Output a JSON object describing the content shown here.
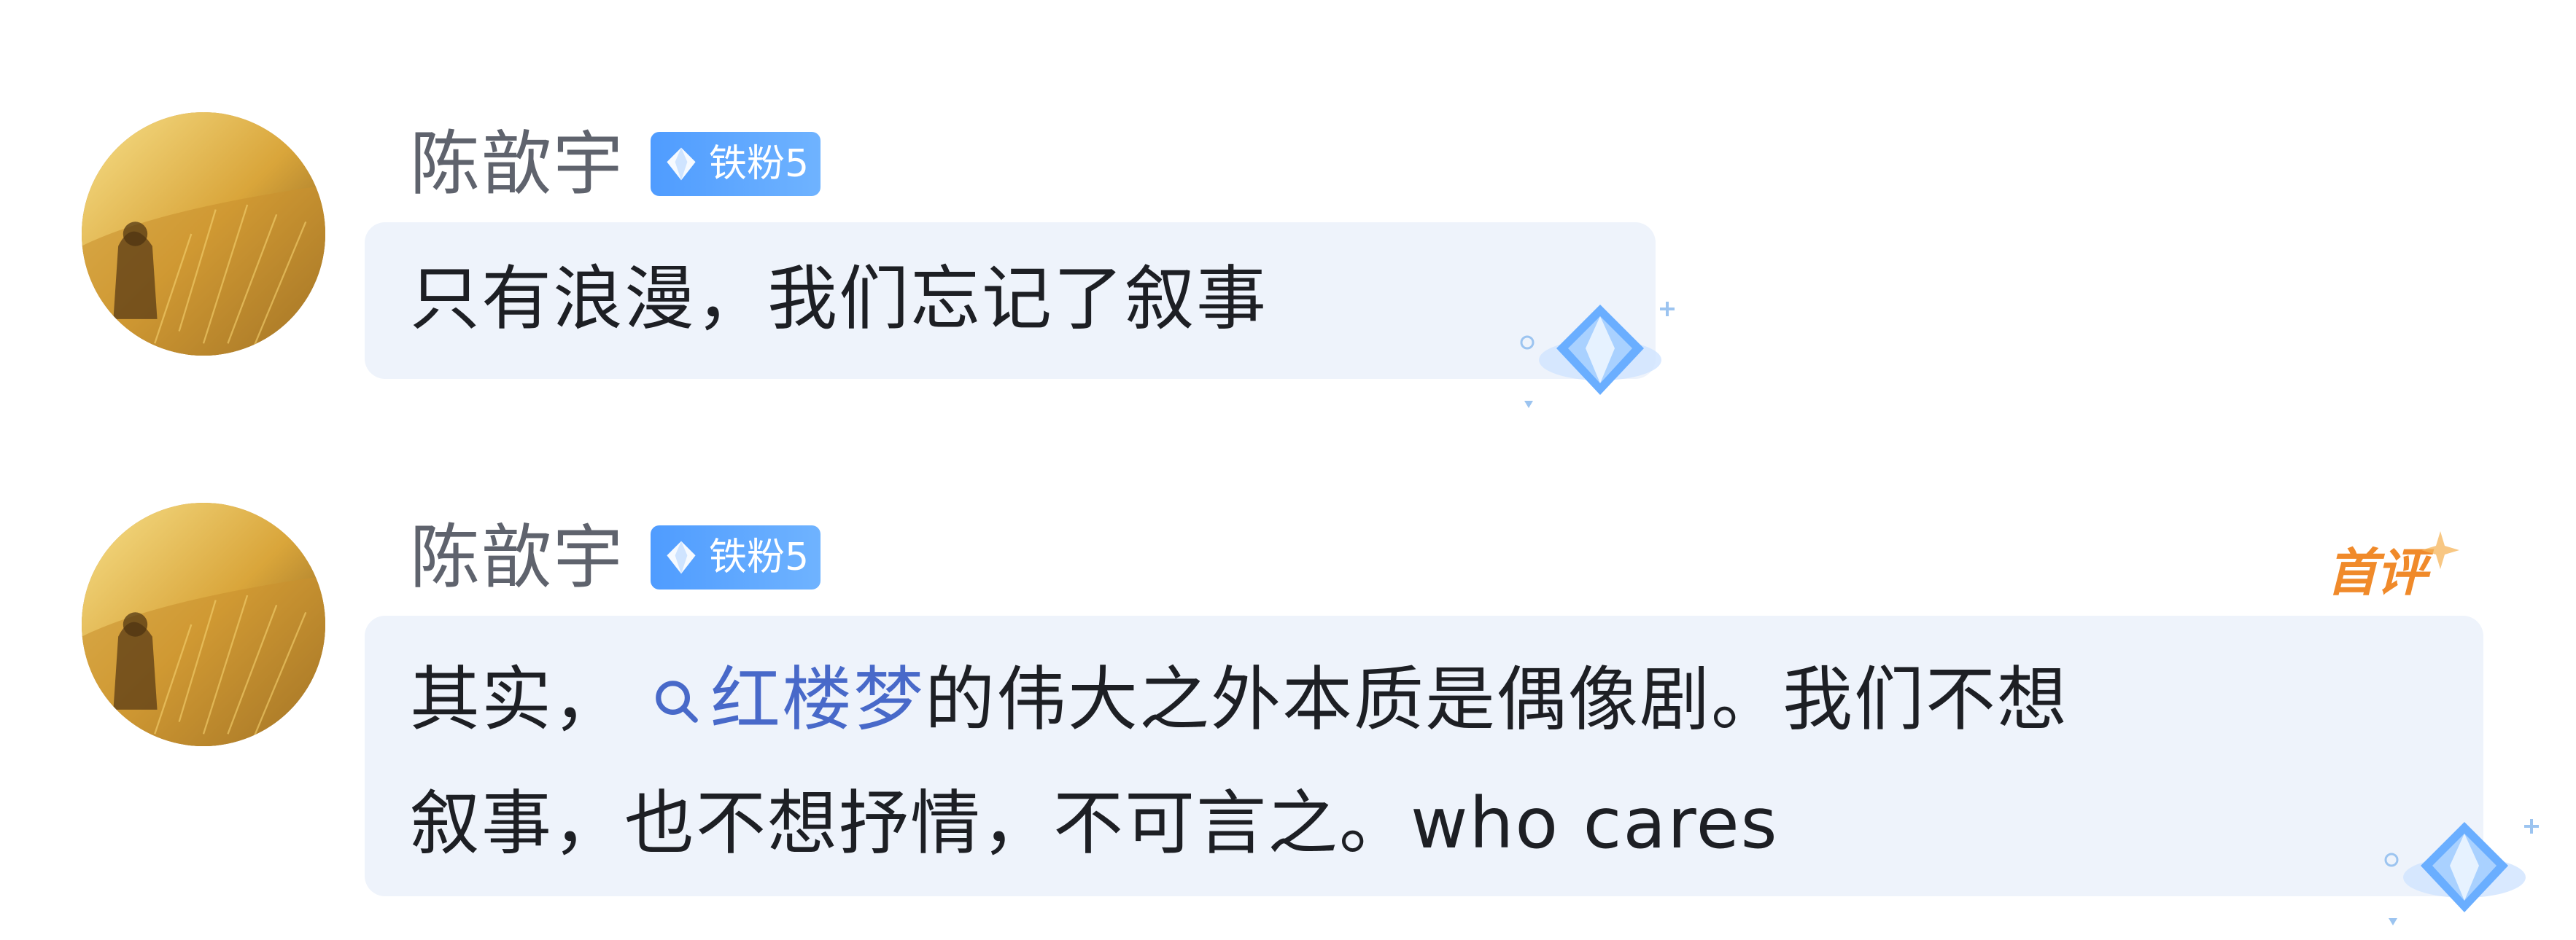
{
  "comments": [
    {
      "username": "陈歆宇",
      "badge": "铁粉5",
      "text_segments": [
        "只有浪漫，我们忘记了叙事"
      ],
      "decoration_icon": "diamond-gem-icon"
    },
    {
      "username": "陈歆宇",
      "badge": "铁粉5",
      "tag": "首评",
      "line1_prefix": "其实，",
      "search_term": "红楼梦",
      "line1_suffix": "的伟大之外本质是偶像剧。我们不想",
      "line2": "叙事，也不想抒情，不可言之。who cares",
      "decoration_icon": "diamond-gem-icon"
    }
  ],
  "icons": {
    "badge": "diamond-icon",
    "search": "search-icon",
    "avatar": "avatar-wheat-field"
  },
  "colors": {
    "username": "#5f636d",
    "text": "#1d1f24",
    "badge_bg": "#5aa5ff",
    "search_link": "#4869c9",
    "bubble_bg": "#eef3fb",
    "first_comment_tag": "#f08a2a"
  }
}
